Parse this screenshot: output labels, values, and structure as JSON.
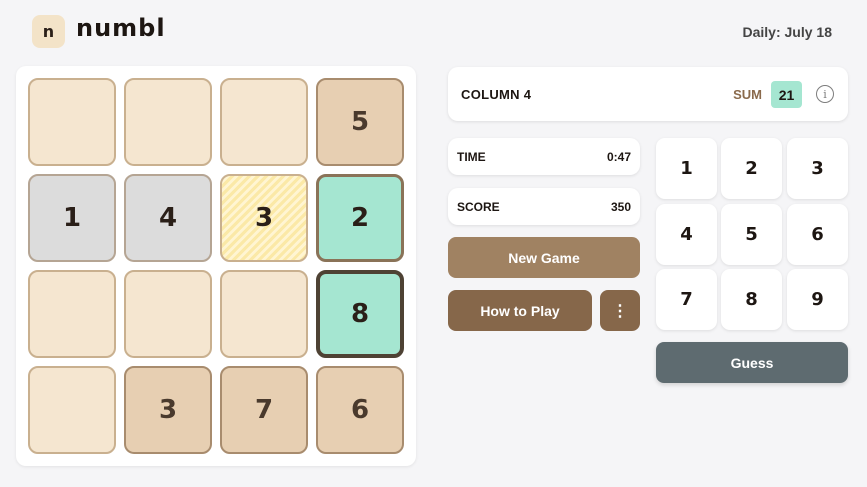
{
  "header": {
    "logo_glyph": "n",
    "title": "numbl",
    "daily": "Daily: July 18"
  },
  "board": {
    "cells": [
      {
        "value": "",
        "style": "empty"
      },
      {
        "value": "",
        "style": "empty"
      },
      {
        "value": "",
        "style": "empty"
      },
      {
        "value": "5",
        "style": "given"
      },
      {
        "value": "1",
        "style": "gray"
      },
      {
        "value": "4",
        "style": "gray"
      },
      {
        "value": "3",
        "style": "hatch"
      },
      {
        "value": "2",
        "style": "mint"
      },
      {
        "value": "",
        "style": "empty"
      },
      {
        "value": "",
        "style": "empty"
      },
      {
        "value": "",
        "style": "empty"
      },
      {
        "value": "8",
        "style": "mint-dark"
      },
      {
        "value": "",
        "style": "empty"
      },
      {
        "value": "3",
        "style": "given"
      },
      {
        "value": "7",
        "style": "given"
      },
      {
        "value": "6",
        "style": "given"
      }
    ]
  },
  "clue": {
    "label": "COLUMN 4",
    "sum_label": "SUM",
    "sum_value": "21",
    "info_icon": "info-icon"
  },
  "stats": {
    "time_label": "TIME",
    "time_value": "0:47",
    "score_label": "SCORE",
    "score_value": "350"
  },
  "buttons": {
    "new_game": "New Game",
    "how_to_play": "How to Play",
    "more": "⋮",
    "guess": "Guess"
  },
  "keypad": [
    "1",
    "2",
    "3",
    "4",
    "5",
    "6",
    "7",
    "8",
    "9"
  ],
  "colors": {
    "cell_empty": "#f5e6d0",
    "cell_given": "#e7cfb2",
    "cell_gray": "#dcdcdc",
    "cell_mint": "#a5e6d1",
    "hatch_yellow": "#fbe9a7",
    "new_game_btn": "#a08262",
    "how_to_play_btn": "#86674a",
    "guess_btn": "#5e6b70"
  }
}
